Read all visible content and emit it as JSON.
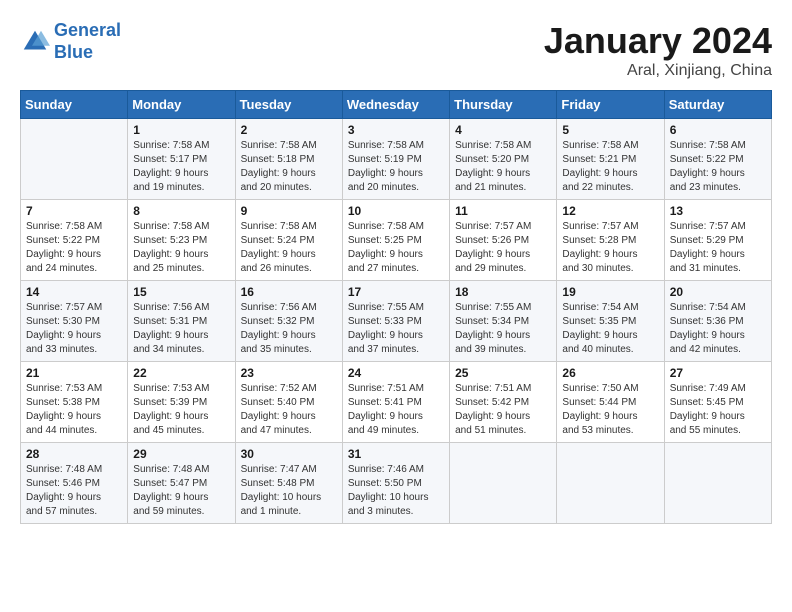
{
  "header": {
    "logo_line1": "General",
    "logo_line2": "Blue",
    "month_title": "January 2024",
    "location": "Aral, Xinjiang, China"
  },
  "days_of_week": [
    "Sunday",
    "Monday",
    "Tuesday",
    "Wednesday",
    "Thursday",
    "Friday",
    "Saturday"
  ],
  "weeks": [
    [
      {
        "day": "",
        "info": ""
      },
      {
        "day": "1",
        "info": "Sunrise: 7:58 AM\nSunset: 5:17 PM\nDaylight: 9 hours\nand 19 minutes."
      },
      {
        "day": "2",
        "info": "Sunrise: 7:58 AM\nSunset: 5:18 PM\nDaylight: 9 hours\nand 20 minutes."
      },
      {
        "day": "3",
        "info": "Sunrise: 7:58 AM\nSunset: 5:19 PM\nDaylight: 9 hours\nand 20 minutes."
      },
      {
        "day": "4",
        "info": "Sunrise: 7:58 AM\nSunset: 5:20 PM\nDaylight: 9 hours\nand 21 minutes."
      },
      {
        "day": "5",
        "info": "Sunrise: 7:58 AM\nSunset: 5:21 PM\nDaylight: 9 hours\nand 22 minutes."
      },
      {
        "day": "6",
        "info": "Sunrise: 7:58 AM\nSunset: 5:22 PM\nDaylight: 9 hours\nand 23 minutes."
      }
    ],
    [
      {
        "day": "7",
        "info": "Sunrise: 7:58 AM\nSunset: 5:22 PM\nDaylight: 9 hours\nand 24 minutes."
      },
      {
        "day": "8",
        "info": "Sunrise: 7:58 AM\nSunset: 5:23 PM\nDaylight: 9 hours\nand 25 minutes."
      },
      {
        "day": "9",
        "info": "Sunrise: 7:58 AM\nSunset: 5:24 PM\nDaylight: 9 hours\nand 26 minutes."
      },
      {
        "day": "10",
        "info": "Sunrise: 7:58 AM\nSunset: 5:25 PM\nDaylight: 9 hours\nand 27 minutes."
      },
      {
        "day": "11",
        "info": "Sunrise: 7:57 AM\nSunset: 5:26 PM\nDaylight: 9 hours\nand 29 minutes."
      },
      {
        "day": "12",
        "info": "Sunrise: 7:57 AM\nSunset: 5:28 PM\nDaylight: 9 hours\nand 30 minutes."
      },
      {
        "day": "13",
        "info": "Sunrise: 7:57 AM\nSunset: 5:29 PM\nDaylight: 9 hours\nand 31 minutes."
      }
    ],
    [
      {
        "day": "14",
        "info": "Sunrise: 7:57 AM\nSunset: 5:30 PM\nDaylight: 9 hours\nand 33 minutes."
      },
      {
        "day": "15",
        "info": "Sunrise: 7:56 AM\nSunset: 5:31 PM\nDaylight: 9 hours\nand 34 minutes."
      },
      {
        "day": "16",
        "info": "Sunrise: 7:56 AM\nSunset: 5:32 PM\nDaylight: 9 hours\nand 35 minutes."
      },
      {
        "day": "17",
        "info": "Sunrise: 7:55 AM\nSunset: 5:33 PM\nDaylight: 9 hours\nand 37 minutes."
      },
      {
        "day": "18",
        "info": "Sunrise: 7:55 AM\nSunset: 5:34 PM\nDaylight: 9 hours\nand 39 minutes."
      },
      {
        "day": "19",
        "info": "Sunrise: 7:54 AM\nSunset: 5:35 PM\nDaylight: 9 hours\nand 40 minutes."
      },
      {
        "day": "20",
        "info": "Sunrise: 7:54 AM\nSunset: 5:36 PM\nDaylight: 9 hours\nand 42 minutes."
      }
    ],
    [
      {
        "day": "21",
        "info": "Sunrise: 7:53 AM\nSunset: 5:38 PM\nDaylight: 9 hours\nand 44 minutes."
      },
      {
        "day": "22",
        "info": "Sunrise: 7:53 AM\nSunset: 5:39 PM\nDaylight: 9 hours\nand 45 minutes."
      },
      {
        "day": "23",
        "info": "Sunrise: 7:52 AM\nSunset: 5:40 PM\nDaylight: 9 hours\nand 47 minutes."
      },
      {
        "day": "24",
        "info": "Sunrise: 7:51 AM\nSunset: 5:41 PM\nDaylight: 9 hours\nand 49 minutes."
      },
      {
        "day": "25",
        "info": "Sunrise: 7:51 AM\nSunset: 5:42 PM\nDaylight: 9 hours\nand 51 minutes."
      },
      {
        "day": "26",
        "info": "Sunrise: 7:50 AM\nSunset: 5:44 PM\nDaylight: 9 hours\nand 53 minutes."
      },
      {
        "day": "27",
        "info": "Sunrise: 7:49 AM\nSunset: 5:45 PM\nDaylight: 9 hours\nand 55 minutes."
      }
    ],
    [
      {
        "day": "28",
        "info": "Sunrise: 7:48 AM\nSunset: 5:46 PM\nDaylight: 9 hours\nand 57 minutes."
      },
      {
        "day": "29",
        "info": "Sunrise: 7:48 AM\nSunset: 5:47 PM\nDaylight: 9 hours\nand 59 minutes."
      },
      {
        "day": "30",
        "info": "Sunrise: 7:47 AM\nSunset: 5:48 PM\nDaylight: 10 hours\nand 1 minute."
      },
      {
        "day": "31",
        "info": "Sunrise: 7:46 AM\nSunset: 5:50 PM\nDaylight: 10 hours\nand 3 minutes."
      },
      {
        "day": "",
        "info": ""
      },
      {
        "day": "",
        "info": ""
      },
      {
        "day": "",
        "info": ""
      }
    ]
  ]
}
